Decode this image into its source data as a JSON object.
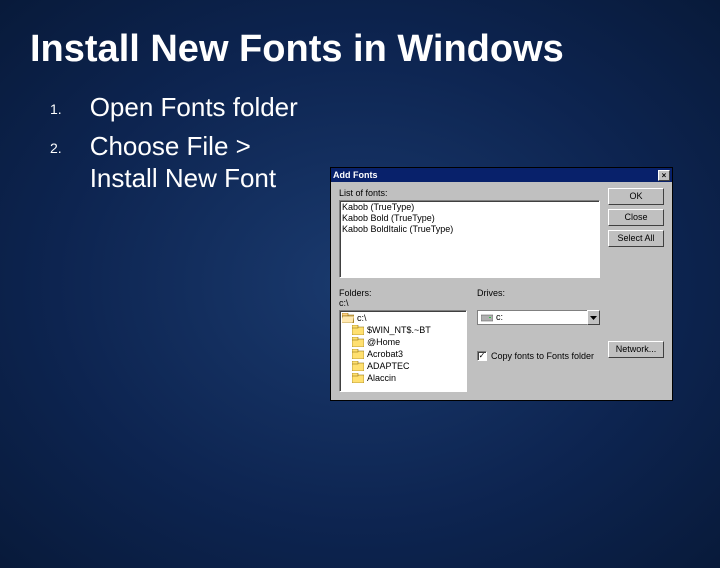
{
  "slide": {
    "title": "Install New Fonts in Windows",
    "bullet1_num": "1.",
    "bullet1_text": "Open Fonts folder",
    "bullet2_num": "2.",
    "bullet2_text": "Choose File > Install New Font"
  },
  "dialog": {
    "title": "Add Fonts",
    "close_glyph": "×",
    "list_label": "List of fonts:",
    "fonts": [
      "Kabob (TrueType)",
      "Kabob Bold (TrueType)",
      "Kabob BoldItalic (TrueType)"
    ],
    "ok": "OK",
    "close": "Close",
    "select_all": "Select All",
    "folders_label": "Folders:",
    "folders_path": "c:\\",
    "drives_label": "Drives:",
    "network": "Network...",
    "dir_root": "c:\\",
    "dirs": [
      "$WIN_NT$.~BT",
      "@Home",
      "Acrobat3",
      "ADAPTEC",
      "Alaccin"
    ],
    "drive_selected": "c:",
    "copy_label": "Copy fonts to Fonts folder",
    "copy_checked": "✓"
  }
}
